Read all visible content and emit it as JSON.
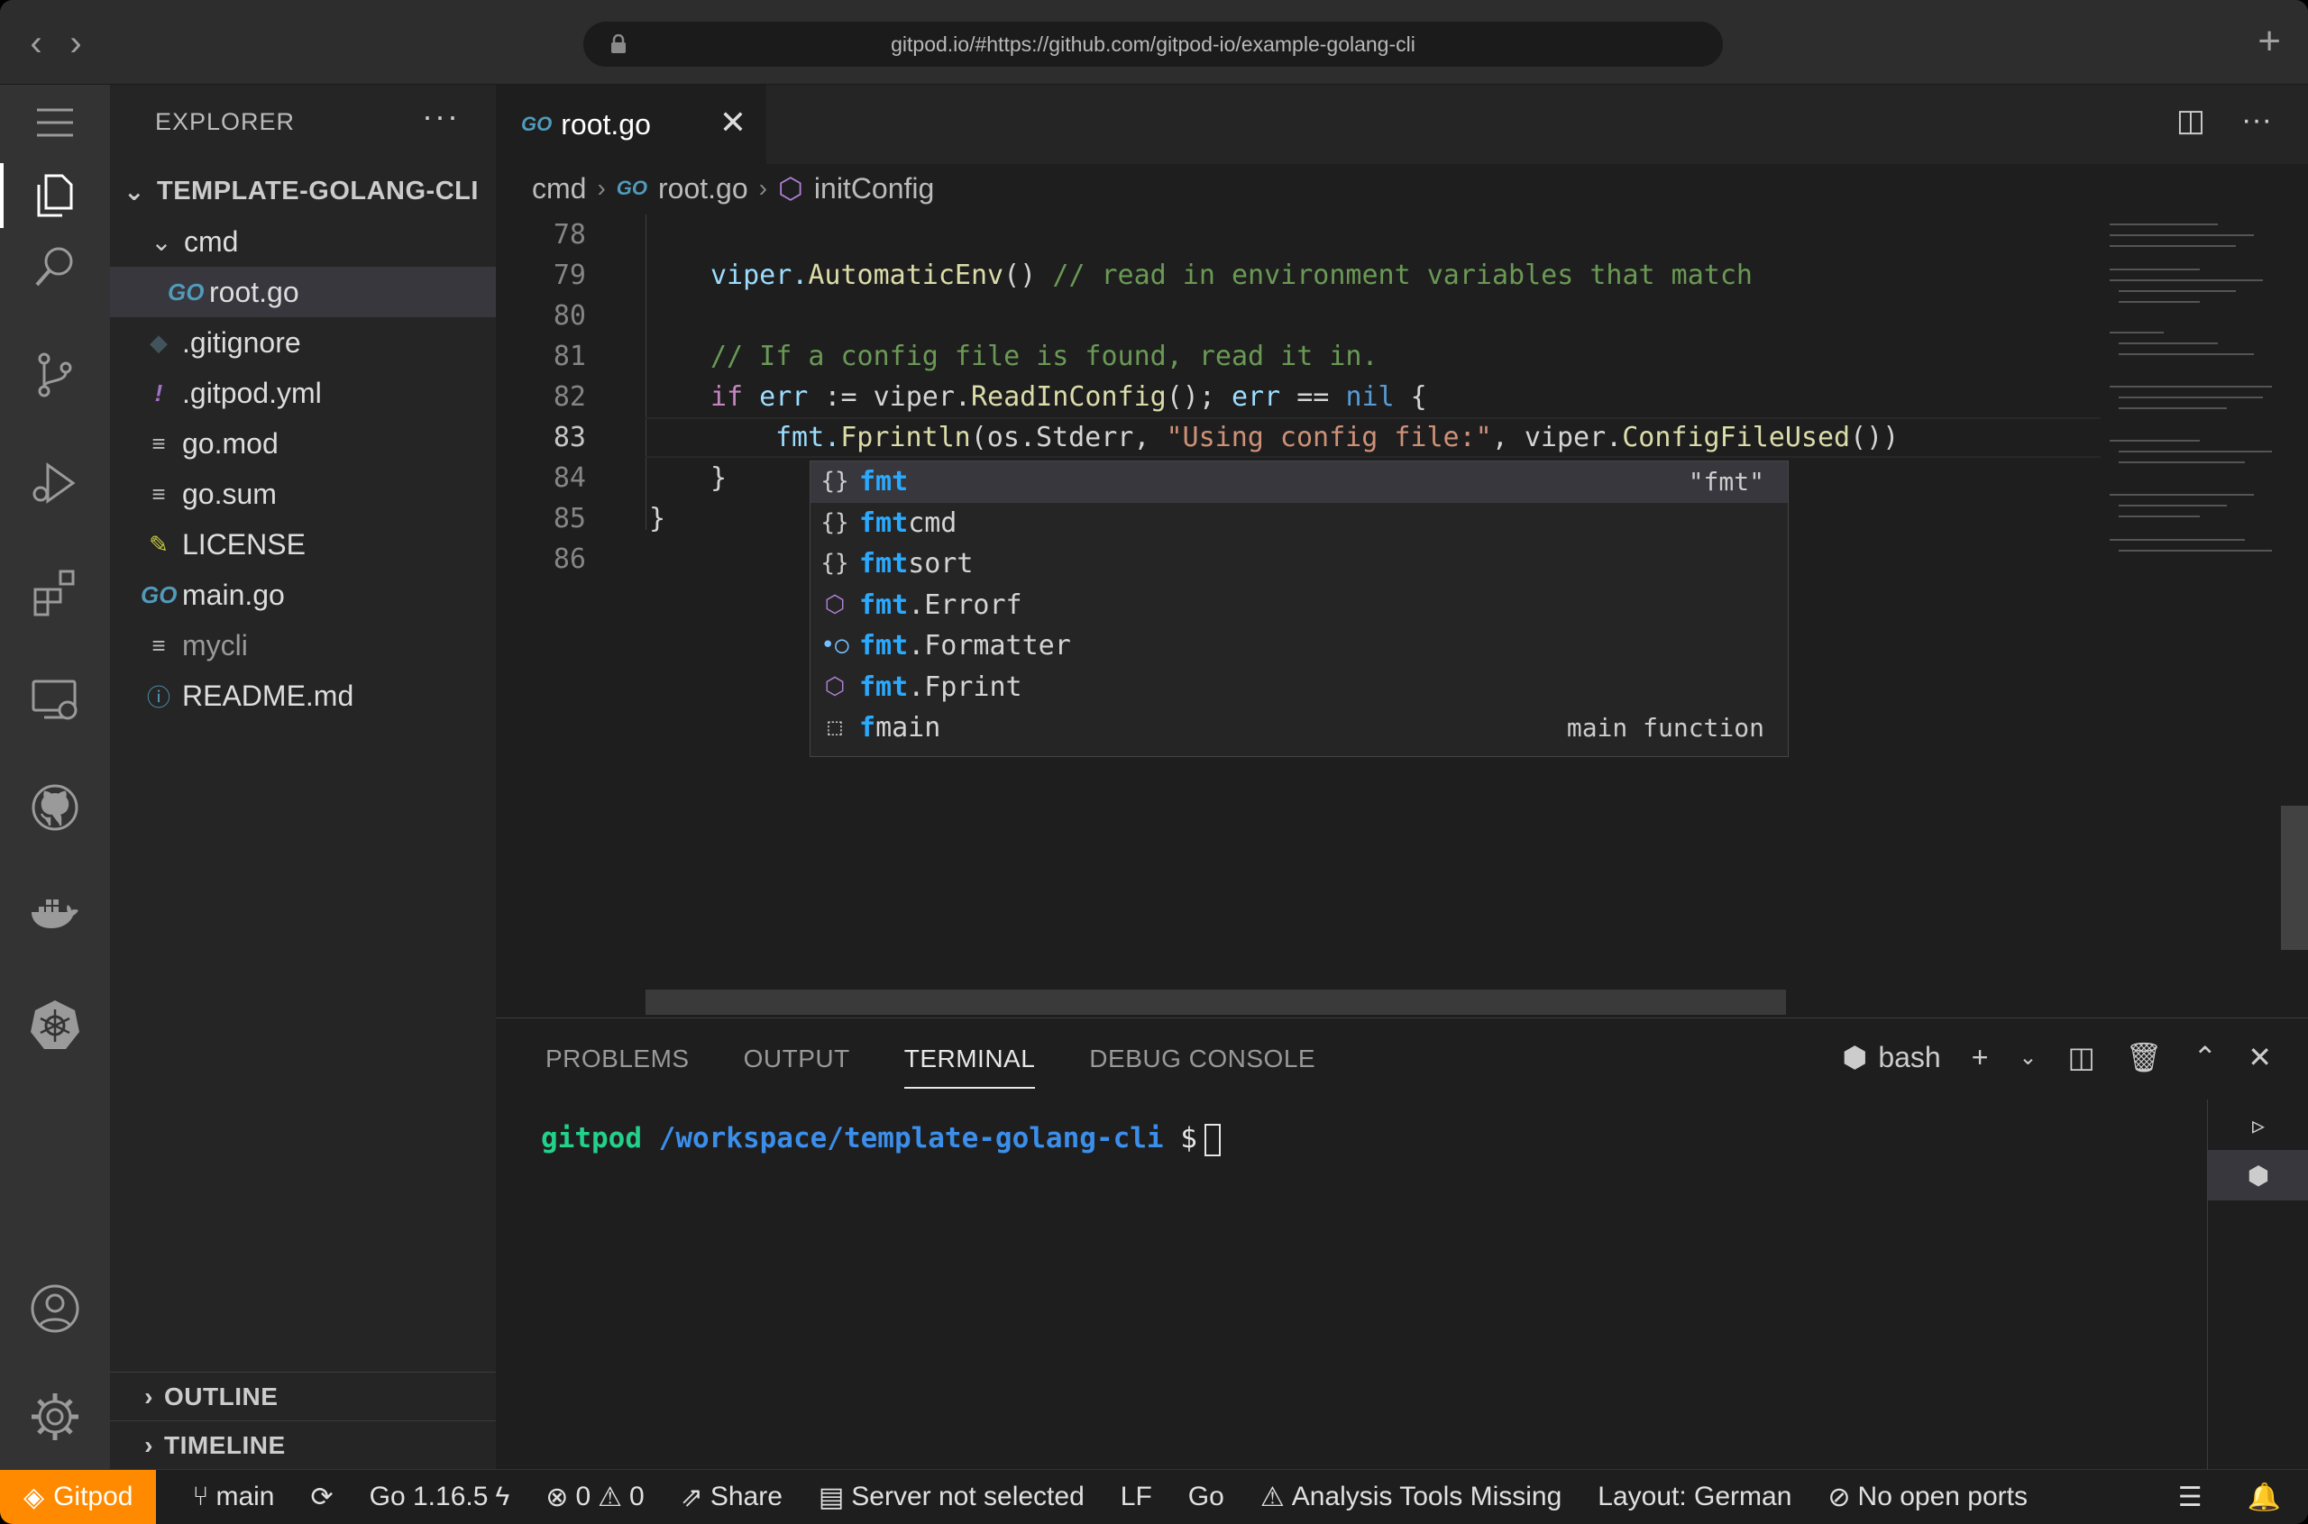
{
  "browser": {
    "url": "gitpod.io/#https://github.com/gitpod-io/example-golang-cli"
  },
  "sidebar": {
    "title": "EXPLORER",
    "root_folder": "TEMPLATE-GOLANG-CLI",
    "items": [
      {
        "label": "cmd",
        "type": "folder"
      },
      {
        "label": "root.go",
        "type": "go"
      },
      {
        "label": ".gitignore",
        "type": "git"
      },
      {
        "label": ".gitpod.yml",
        "type": "yml"
      },
      {
        "label": "go.mod",
        "type": "text"
      },
      {
        "label": "go.sum",
        "type": "text"
      },
      {
        "label": "LICENSE",
        "type": "license"
      },
      {
        "label": "main.go",
        "type": "go"
      },
      {
        "label": "mycli",
        "type": "text"
      },
      {
        "label": "README.md",
        "type": "info"
      }
    ],
    "sections": {
      "outline": "OUTLINE",
      "timeline": "TIMELINE"
    }
  },
  "editor": {
    "tab_label": "root.go",
    "breadcrumb": [
      "cmd",
      "root.go",
      "initConfig"
    ],
    "line_numbers": [
      "78",
      "79",
      "80",
      "81",
      "82",
      "83",
      "84",
      "85",
      "86"
    ],
    "code": {
      "l79_a": "viper.",
      "l79_fn": "AutomaticEnv",
      "l79_b": "() ",
      "l79_cm": "// read in environment variables that match",
      "l81_cm": "// If a config file is found, read it in.",
      "l82_if": "if",
      "l82_err": " err",
      "l82_a": " := viper.",
      "l82_fn": "ReadInConfig",
      "l82_b": "(); ",
      "l82_err2": "err",
      "l82_c": " == ",
      "l82_nil": "nil",
      "l82_d": " {",
      "l83_a": "fmt.",
      "l83_fn": "Fprintln",
      "l83_b": "(os.Stderr, ",
      "l83_str": "\"Using config file:\"",
      "l83_c": ", viper.",
      "l83_fn2": "ConfigFileUsed",
      "l83_d": "())",
      "l84": "}",
      "l85": "}"
    }
  },
  "suggest": {
    "items": [
      {
        "hl": "fmt",
        "rest": "",
        "icon": "{}",
        "detail": "\"fmt\""
      },
      {
        "hl": "fmt",
        "rest": "cmd",
        "icon": "{}",
        "detail": ""
      },
      {
        "hl": "fmt",
        "rest": "sort",
        "icon": "{}",
        "detail": ""
      },
      {
        "hl": "fmt",
        "rest": ".Errorf",
        "icon": "cube",
        "detail": ""
      },
      {
        "hl": "fmt",
        "rest": ".Formatter",
        "icon": "interface",
        "detail": ""
      },
      {
        "hl": "fmt",
        "rest": ".Fprint",
        "icon": "cube",
        "detail": ""
      },
      {
        "hl": "f",
        "rest": "main",
        "icon": "snippet",
        "detail": "main function"
      }
    ]
  },
  "panel": {
    "tabs": [
      "PROBLEMS",
      "OUTPUT",
      "TERMINAL",
      "DEBUG CONSOLE"
    ],
    "active_tab": "TERMINAL",
    "shell": "bash",
    "terminal": {
      "user": "gitpod",
      "path": "/workspace/template-golang-cli",
      "prompt": "$"
    }
  },
  "statusbar": {
    "gitpod": "Gitpod",
    "branch": "main",
    "go_version": "Go 1.16.5",
    "errors": "0",
    "warnings": "0",
    "share": "Share",
    "server": "Server not selected",
    "eol": "LF",
    "language": "Go",
    "analysis": "Analysis Tools Missing",
    "layout": "Layout: German",
    "ports": "No open ports"
  },
  "colors": {
    "accent": "#ff8a00",
    "highlight": "#2aaaff"
  }
}
